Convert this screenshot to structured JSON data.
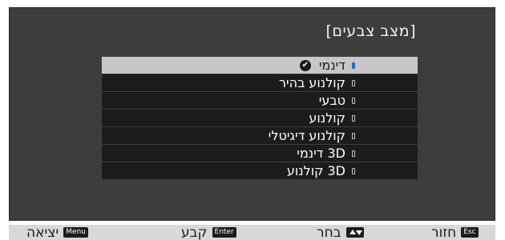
{
  "dialog": {
    "title": "[מצב צבעים]"
  },
  "menu": {
    "items": [
      {
        "label": "דינמי",
        "selected": true,
        "checked": true
      },
      {
        "label": "קולנוע בהיר",
        "selected": false,
        "checked": false
      },
      {
        "label": "טבעי",
        "selected": false,
        "checked": false
      },
      {
        "label": "קולנוע",
        "selected": false,
        "checked": false
      },
      {
        "label": "קולנוע דיגיטלי",
        "selected": false,
        "checked": false
      },
      {
        "label": "3D דינמי",
        "selected": false,
        "checked": false
      },
      {
        "label": "3D קולנוע",
        "selected": false,
        "checked": false
      }
    ],
    "checkmark_glyph": "✔",
    "colors": {
      "selected_bg": "#c7c7c7",
      "item_bg": "#1c1c1c",
      "accent": "#1e6fd0"
    }
  },
  "footer": {
    "exit": {
      "key": "Menu",
      "label": "יציאה"
    },
    "set": {
      "key": "Enter",
      "label": "קבע"
    },
    "select": {
      "key_icon": "up-down-arrows-icon",
      "label": "בחר"
    },
    "back": {
      "key": "Esc",
      "label": "חזור"
    }
  }
}
